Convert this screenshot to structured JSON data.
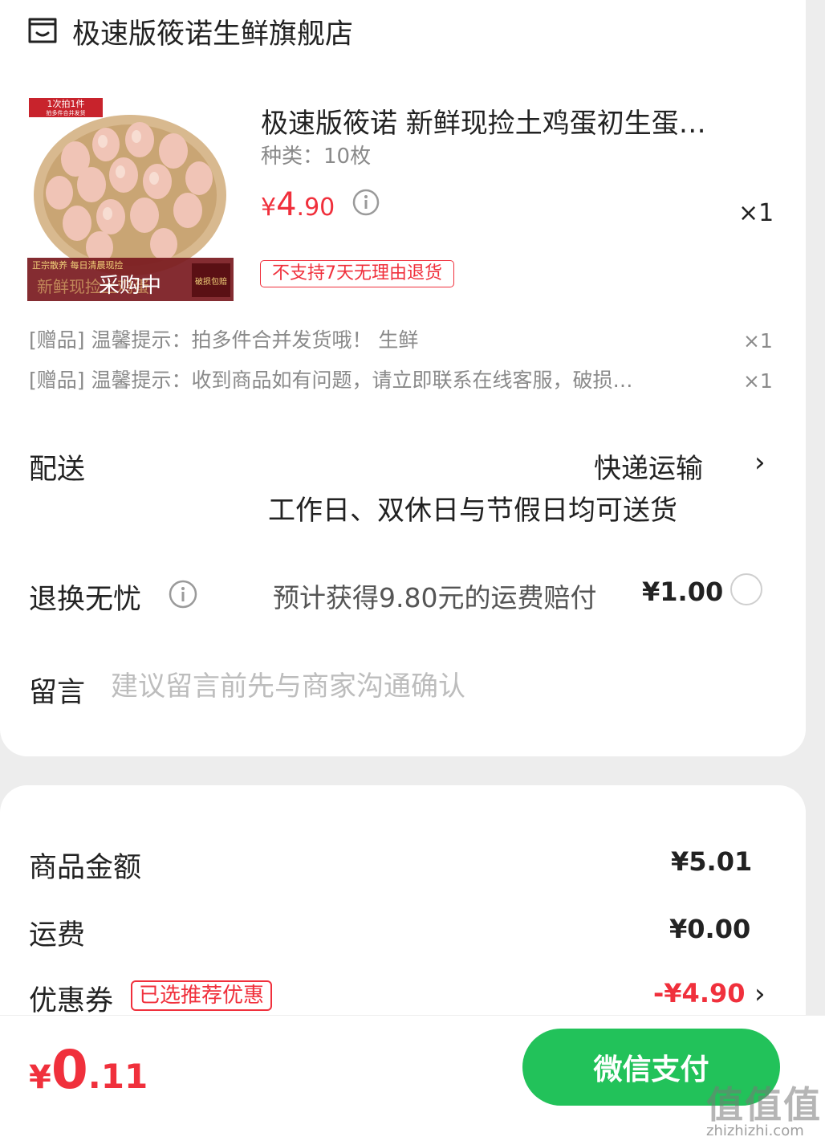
{
  "store": {
    "icon": "store-icon",
    "name": "极速版筱诺生鲜旗舰店"
  },
  "product": {
    "image_top_tag": "1次拍1件",
    "image_top_tag_sub": "拍多件合并发货",
    "image_banner_left": "正宗散养 每日清晨现捡",
    "image_banner_main": "新鲜现捡土鸡蛋",
    "image_banner_right": "破损包赔",
    "image_status": "采购中",
    "title": "极速版筱诺 新鲜现捡土鸡蛋初生蛋…",
    "spec": "种类：10枚",
    "price_currency": "¥",
    "price_int": "4",
    "price_dec": ".90",
    "quantity": "×1",
    "return_policy_badge": "不支持7天无理由退货",
    "accent_color": "#f0303c"
  },
  "gifts": [
    {
      "text": "[赠品] 温馨提示：拍多件合并发货哦！ 生鲜",
      "quantity": "×1"
    },
    {
      "text": "[赠品] 温馨提示：收到商品如有问题，请立即联系在线客服，破损…",
      "quantity": "×1"
    }
  ],
  "delivery": {
    "label": "配送",
    "method": "快递运输",
    "schedule": "工作日、双休日与节假日均可送货",
    "chevron": "›"
  },
  "return_insurance": {
    "label": "退换无忧",
    "description": "预计获得9.80元的运费赔付",
    "price": "¥1.00",
    "selected": false
  },
  "message": {
    "label": "留言",
    "placeholder": "建议留言前先与商家沟通确认",
    "value": ""
  },
  "summary": {
    "goods_amount_label": "商品金额",
    "goods_amount_value": "¥5.01",
    "shipping_label": "运费",
    "shipping_value": "¥0.00",
    "coupon_label": "优惠券",
    "coupon_badge": "已选推荐优惠",
    "coupon_value": "-¥4.90",
    "coupon_chevron": "›"
  },
  "footer": {
    "total_currency": "¥",
    "total_int": "0",
    "total_dec": ".11",
    "pay_button": "微信支付",
    "pay_color": "#22c25a"
  },
  "watermark": {
    "mark": "值值值",
    "url": "zhizhizhi.com"
  }
}
